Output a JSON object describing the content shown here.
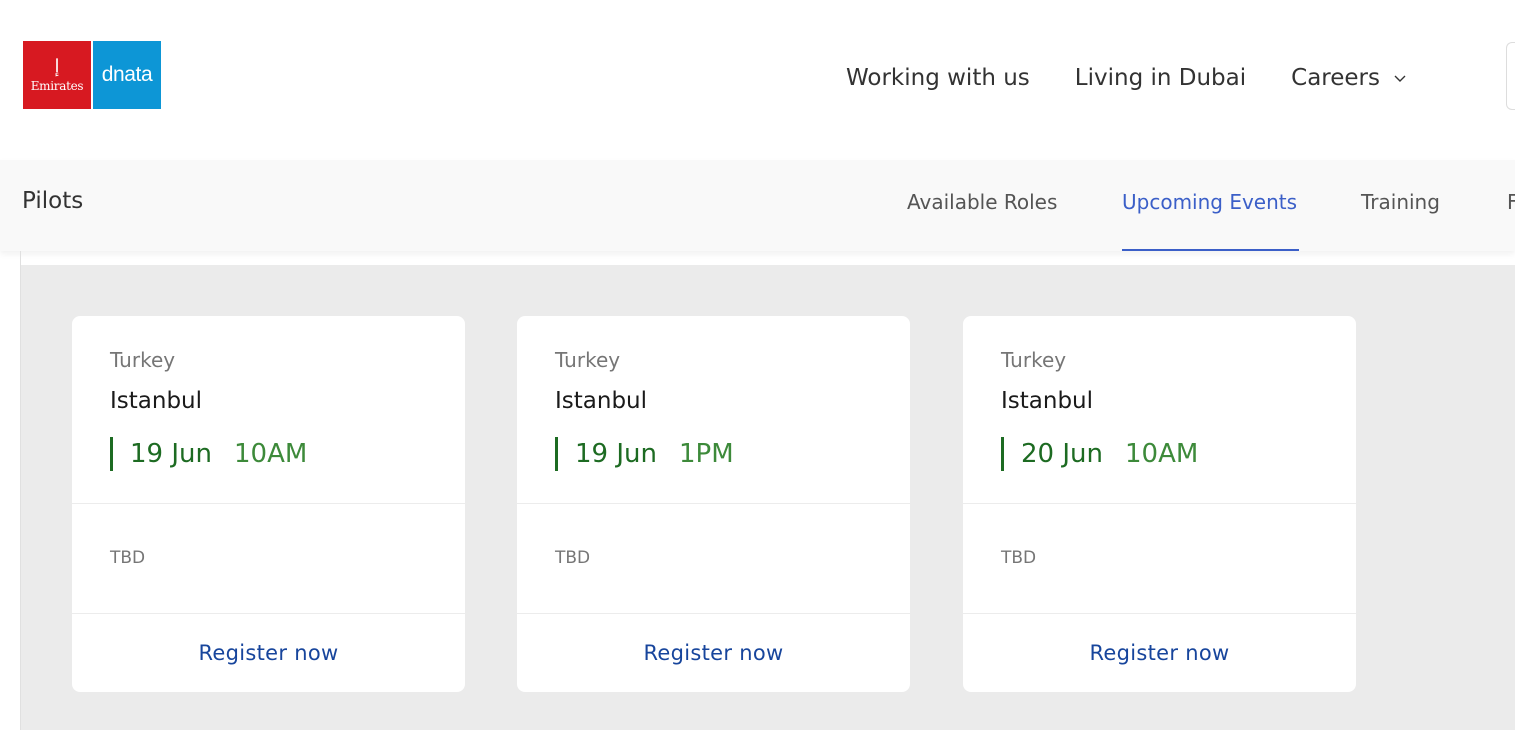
{
  "header": {
    "logo": {
      "emirates_text": "Emirates",
      "dnata_text": "dnata"
    },
    "nav": [
      {
        "label": "Working with us"
      },
      {
        "label": "Living in Dubai"
      },
      {
        "label": "Careers",
        "icon": "chevron-down-icon"
      }
    ]
  },
  "subnav": {
    "title": "Pilots",
    "tabs": [
      {
        "label": "Available Roles"
      },
      {
        "label": "Upcoming Events",
        "active": true
      },
      {
        "label": "Training"
      },
      {
        "label": "F"
      }
    ]
  },
  "events": [
    {
      "country": "Turkey",
      "city": "Istanbul",
      "date": "19 Jun",
      "time": "10AM",
      "venue": "TBD",
      "cta": "Register now"
    },
    {
      "country": "Turkey",
      "city": "Istanbul",
      "date": "19 Jun",
      "time": "1PM",
      "venue": "TBD",
      "cta": "Register now"
    },
    {
      "country": "Turkey",
      "city": "Istanbul",
      "date": "20 Jun",
      "time": "10AM",
      "venue": "TBD",
      "cta": "Register now"
    }
  ],
  "colors": {
    "emirates_red": "#d71921",
    "dnata_blue": "#0d96d6",
    "active_tab": "#3b5fc8",
    "date_green": "#1d6b22",
    "register_blue": "#17459c",
    "content_bg": "#ebebeb"
  }
}
